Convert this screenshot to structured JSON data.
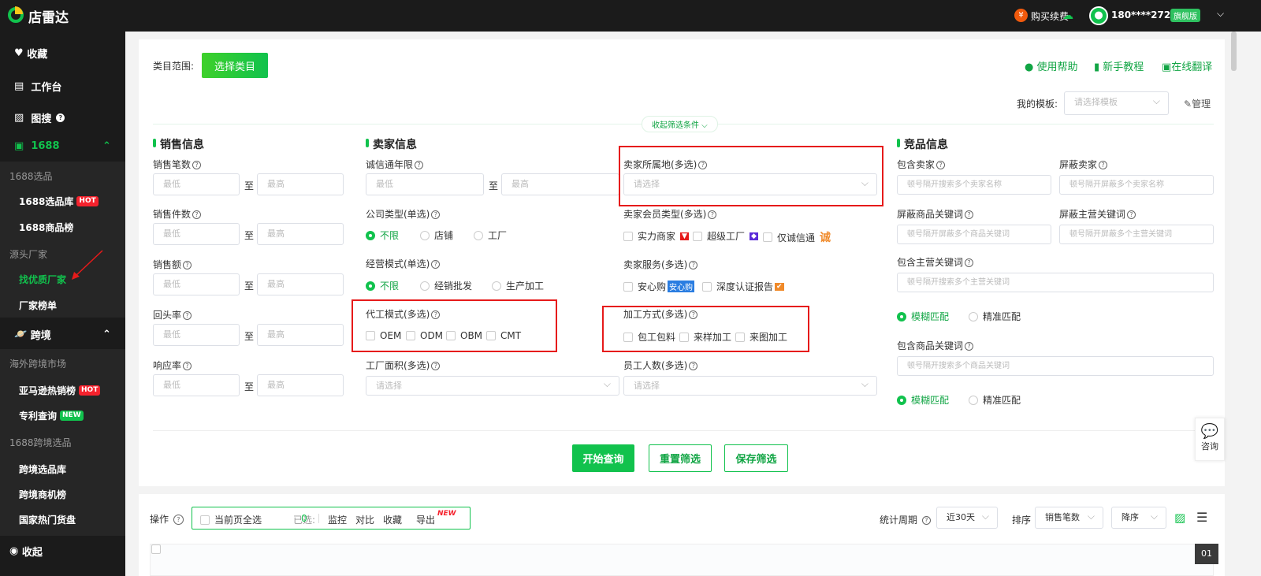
{
  "header": {
    "logo": "店雷达",
    "buy": "购买续费",
    "phone": "180****2729",
    "vip": "旗舰版"
  },
  "sidebar": {
    "fav": "收藏",
    "workbench": "工作台",
    "imgsearch": "图搜",
    "s1688": "1688",
    "g1": "1688选品",
    "i1": "1688选品库",
    "i1_badge": "HOT",
    "i2": "1688商品榜",
    "g2": "源头厂家",
    "i3": "找优质厂家",
    "i4": "厂家榜单",
    "cross": "跨境",
    "g3": "海外跨境市场",
    "i5": "亚马逊热销榜",
    "i5_badge": "HOT",
    "i6": "专利查询",
    "i6_badge": "NEW",
    "g4": "1688跨境选品",
    "i7": "跨境选品库",
    "i8": "跨境商机榜",
    "i9": "国家热门货盘",
    "collapse": "收起"
  },
  "top": {
    "category_label": "类目范围:",
    "category_btn": "选择类目",
    "help": "使用帮助",
    "tutorial": "新手教程",
    "translate": "在线翻译",
    "template_label": "我的模板:",
    "template_placeholder": "请选择模板",
    "manage": "管理",
    "fold": "收起筛选条件"
  },
  "sales": {
    "title": "销售信息",
    "fields": [
      "销售笔数",
      "销售件数",
      "销售额",
      "回头率",
      "响应率"
    ],
    "min": "最低",
    "max": "最高",
    "to": "至"
  },
  "seller": {
    "title": "卖家信息",
    "years": "诚信通年限",
    "company_type": "公司类型(单选)",
    "company_opts": [
      "不限",
      "店铺",
      "工厂"
    ],
    "biz_mode": "经营模式(单选)",
    "biz_opts": [
      "不限",
      "经销批发",
      "生产加工"
    ],
    "oem": "代工模式(多选)",
    "oem_opts": [
      "OEM",
      "ODM",
      "OBM",
      "CMT"
    ],
    "area": "工厂面积(多选)",
    "placeholder": "请选择"
  },
  "seller2": {
    "location": "卖家所属地(多选)",
    "member": "卖家会员类型(多选)",
    "member_opts": [
      "实力商家",
      "超级工厂",
      "仅诚信通"
    ],
    "service": "卖家服务(多选)",
    "service_opts": [
      "安心购",
      "深度认证报告"
    ],
    "service_badge": "安心购",
    "cheng": "诚",
    "process": "加工方式(多选)",
    "process_opts": [
      "包工包料",
      "来样加工",
      "来图加工"
    ],
    "staff": "员工人数(多选)"
  },
  "competitor": {
    "title": "竞品信息",
    "inc_seller": "包含卖家",
    "inc_seller_ph": "顿号隔开搜索多个卖家名称",
    "blk_seller": "屏蔽卖家",
    "blk_seller_ph": "顿号隔开屏蔽多个卖家名称",
    "blk_kw": "屏蔽商品关键词",
    "blk_kw_ph": "顿号隔开屏蔽多个商品关键词",
    "blk_main": "屏蔽主营关键词",
    "blk_main_ph": "顿号隔开屏蔽多个主营关键词",
    "inc_main": "包含主营关键词",
    "inc_main_ph": "顿号隔开搜索多个主营关键词",
    "inc_kw": "包含商品关键词",
    "inc_kw_ph": "顿号隔开搜索多个商品关键词",
    "fuzzy": "模糊匹配",
    "exact": "精准匹配"
  },
  "actions": {
    "query": "开始查询",
    "reset": "重置筛选",
    "save": "保存筛选",
    "consult": "咨询"
  },
  "toolbar": {
    "op": "操作",
    "select_all": "当前页全选",
    "selected": "已选:",
    "count": "0",
    "monitor": "监控",
    "compare": "对比",
    "fav": "收藏",
    "export": "导出",
    "new": "NEW",
    "period_label": "统计周期",
    "period": "近30天",
    "sort_label": "排序",
    "sort": "销售笔数",
    "order": "降序",
    "page": "01"
  }
}
